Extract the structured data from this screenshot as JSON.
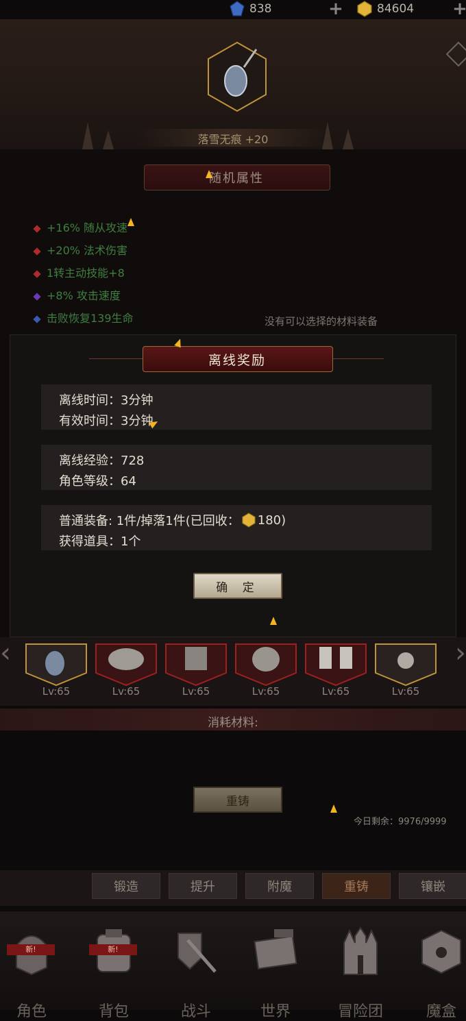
{
  "currencies": {
    "diamond": "838",
    "gold": "84604"
  },
  "item": {
    "name": "落雪无痕 +20"
  },
  "random_attributes": {
    "title": "随机属性",
    "lines": [
      {
        "text": "+16% 随从攻速",
        "color": "#3f7f3f",
        "dot": "#b02a2a"
      },
      {
        "text": "+20% 法术伤害",
        "color": "#3f7f3f",
        "dot": "#b02a2a"
      },
      {
        "text": "1转主动技能+8",
        "color": "#3f7f3f",
        "dot": "#b02a2a"
      },
      {
        "text": "+8% 攻击速度",
        "color": "#3f7f3f",
        "dot": "#6a3ab0"
      },
      {
        "text": "击败恢复139生命",
        "color": "#3f7f3f",
        "dot": "#3a5ab0"
      }
    ],
    "empty_note": "没有可以选择的材料装备"
  },
  "modal": {
    "title": "离线奖励",
    "offline_time": "离线时间：3分钟",
    "effective_time": "有效时间：3分钟",
    "offline_exp": "离线经验：728",
    "char_level": "角色等级：64",
    "equip_prefix": "普通装备: 1件/掉落1件(已回收：",
    "equip_gold": "180)",
    "items_got": "获得道具：1个",
    "confirm": "确 定"
  },
  "equipment": {
    "levels": [
      "Lv:65",
      "Lv:65",
      "Lv:65",
      "Lv:65",
      "Lv:65",
      "Lv:65"
    ]
  },
  "materials": {
    "label": "消耗材料:",
    "recast_button": "重铸",
    "remaining": "今日剩余：9976/9999"
  },
  "tabs": [
    "锻造",
    "提升",
    "附魔",
    "重铸",
    "镶嵌"
  ],
  "active_tab": "重铸",
  "nav": {
    "items": [
      "角色",
      "背包",
      "战斗",
      "世界",
      "冒险团",
      "魔盒"
    ],
    "new_badge": "新!"
  }
}
